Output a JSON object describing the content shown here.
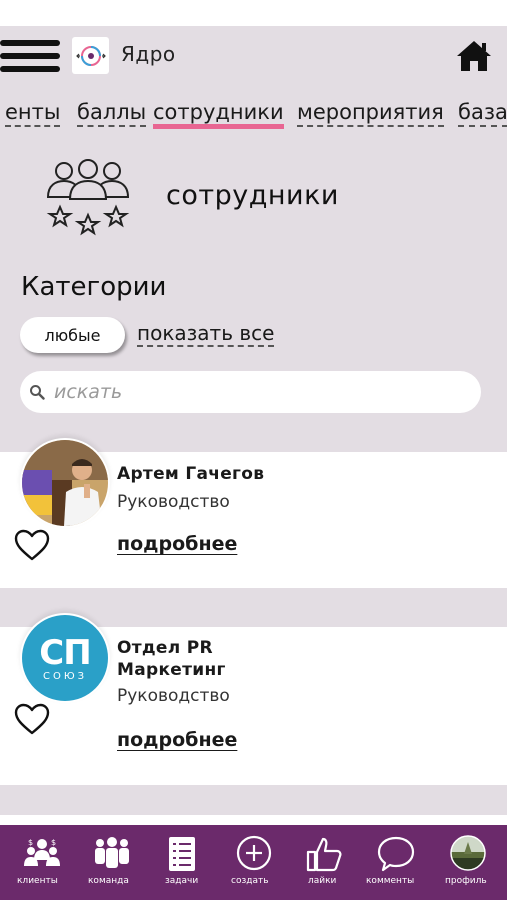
{
  "header": {
    "app_title": "Ядро"
  },
  "tabs": [
    {
      "label": "енты",
      "active": false
    },
    {
      "label": "баллы",
      "active": false
    },
    {
      "label": "сотрудники",
      "active": true
    },
    {
      "label": "мероприятия",
      "active": false
    },
    {
      "label": "база",
      "active": false
    }
  ],
  "section": {
    "title": "сотрудники"
  },
  "categories": {
    "title": "Категории",
    "chip": "любые",
    "show_all": "показать все"
  },
  "search": {
    "placeholder": "искать"
  },
  "cards": [
    {
      "name": "Артем Гачегов",
      "role": "Руководство",
      "more": "подробнее"
    },
    {
      "name_line1": "Отдел PR",
      "name_line2": "Маркетинг",
      "role": "Руководство",
      "more": "подробнее",
      "logo_text": "СП",
      "logo_sub": "СОЮЗ"
    }
  ],
  "bottom_nav": [
    {
      "label": "клиенты",
      "icon": "clients-icon"
    },
    {
      "label": "команда",
      "icon": "team-icon"
    },
    {
      "label": "задачи",
      "icon": "tasks-icon"
    },
    {
      "label": "создать",
      "icon": "plus-circle-icon"
    },
    {
      "label": "лайки",
      "icon": "thumbs-up-icon"
    },
    {
      "label": "комменты",
      "icon": "comment-icon"
    },
    {
      "label": "профиль",
      "icon": "profile-avatar-icon"
    }
  ],
  "colors": {
    "background": "#e3dde3",
    "accent": "#e86592",
    "nav": "#6b2a6b"
  }
}
